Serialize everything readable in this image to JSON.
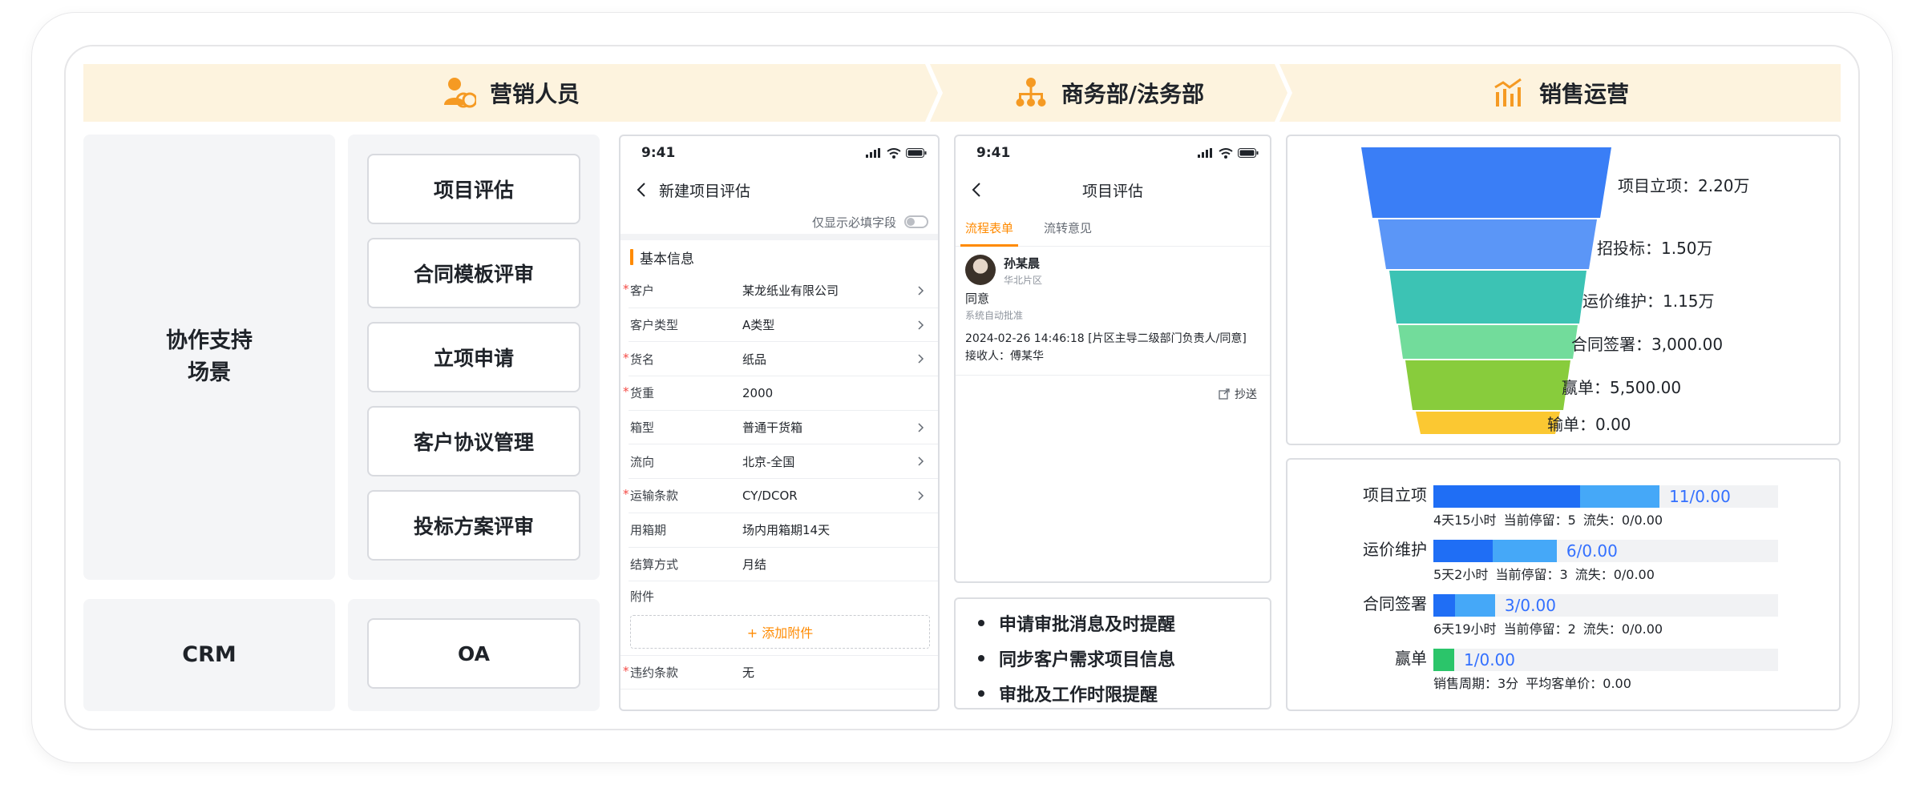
{
  "banners": {
    "sales": "营销人员",
    "business_legal": "商务部/法务部",
    "operations": "销售运营"
  },
  "left": {
    "collab_label_line1": "协作支持",
    "collab_label_line2": "场景",
    "crm_label": "CRM",
    "scenarios": [
      "项目评估",
      "合同模板评审",
      "立项申请",
      "客户协议管理",
      "投标方案评审"
    ],
    "oa_label": "OA"
  },
  "phone1": {
    "time": "9:41",
    "title": "新建项目评估",
    "toggle_label": "仅显示必填字段",
    "section": "基本信息",
    "rows": [
      {
        "label": "客户",
        "value": "某龙纸业有限公司",
        "required": "*",
        "arrow": true
      },
      {
        "label": "客户类型",
        "value": "A类型",
        "required": "",
        "arrow": true
      },
      {
        "label": "货名",
        "value": "纸品",
        "required": "*",
        "arrow": true
      },
      {
        "label": "货重",
        "value": "2000",
        "required": "*",
        "arrow": false
      },
      {
        "label": "箱型",
        "value": "普通干货箱",
        "required": "",
        "arrow": true
      },
      {
        "label": "流向",
        "value": "北京-全国",
        "required": "",
        "arrow": true
      },
      {
        "label": "运输条款",
        "value": "CY/DCOR",
        "required": "*",
        "arrow": true
      },
      {
        "label": "用箱期",
        "value": "场内用箱期14天",
        "required": "",
        "arrow": false
      },
      {
        "label": "结算方式",
        "value": "月结",
        "required": "",
        "arrow": false
      }
    ],
    "attachment_label": "附件",
    "attachment_button": "+ 添加附件",
    "last_row": {
      "label": "违约条款",
      "value": "无",
      "required": "*"
    }
  },
  "phone2": {
    "time": "9:41",
    "title": "项目评估",
    "tabs": [
      "流程表单",
      "流转意见"
    ],
    "approver_name": "孙某晨",
    "approver_dept": "华北片区",
    "approve_result": "同意",
    "approve_sub": "系统自动批准",
    "approve_detail_1": "2024-02-26  14:46:18 [片区主导二级部门负责人/同意]",
    "approve_detail_2": "接收人：傅某华",
    "cc_label": "抄送"
  },
  "bullets": [
    "申请审批消息及时提醒",
    "同步客户需求项目信息",
    "审批及工作时限提醒"
  ],
  "funnel": [
    {
      "label": "项目立项：2.20万",
      "color": "#3a7ef6"
    },
    {
      "label": "招投标：1.50万",
      "color": "#5b96f7"
    },
    {
      "label": "运价维护：1.15万",
      "color": "#3cc3b4"
    },
    {
      "label": "合同签署：3,000.00",
      "color": "#72dc9b"
    },
    {
      "label": "赢单：5,500.00",
      "color": "#88cc3c"
    },
    {
      "label": "输单：0.00",
      "color": "#fbc832"
    }
  ],
  "chart_data": {
    "type": "bar",
    "categories": [
      "项目立项",
      "运价维护",
      "合同签署",
      "赢单"
    ],
    "series": [
      {
        "values": [
          11,
          6,
          3,
          1
        ]
      }
    ],
    "value_labels": [
      "11/0.00",
      "6/0.00",
      "3/0.00",
      "1/0.00"
    ],
    "meta": [
      "4天15小时  当前停留：5  流失：0/0.00",
      "5天2小时  当前停留：3  流失：0/0.00",
      "6天19小时  当前停留：2  流失：0/0.00",
      "销售周期：3分  平均客单价：0.00"
    ],
    "colors": {
      "dark": "#1f6ef5",
      "light": "#45a8f8",
      "win": "#2bc56a"
    }
  }
}
